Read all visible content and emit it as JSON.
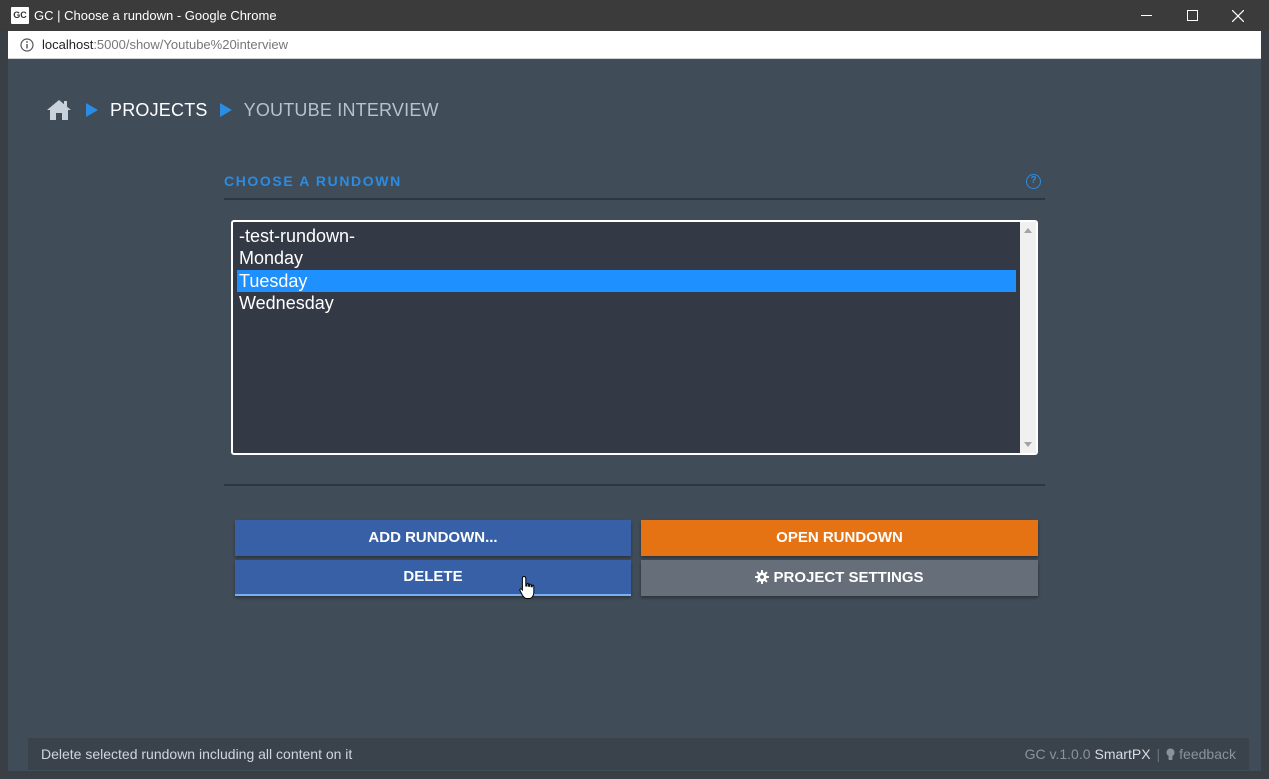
{
  "window": {
    "icon_text": "GC",
    "title": "GC | Choose a rundown - Google Chrome"
  },
  "address": {
    "host": "localhost",
    "path": ":5000/show/Youtube%20interview"
  },
  "breadcrumb": {
    "items": [
      {
        "label": "PROJECTS"
      },
      {
        "label": "YOUTUBE INTERVIEW"
      }
    ]
  },
  "section": {
    "title": "CHOOSE A RUNDOWN",
    "help_text": "?"
  },
  "rundowns": {
    "items": [
      {
        "label": "-test-rundown-",
        "selected": false
      },
      {
        "label": "Monday",
        "selected": false
      },
      {
        "label": "Tuesday",
        "selected": true
      },
      {
        "label": "Wednesday",
        "selected": false
      }
    ]
  },
  "buttons": {
    "add_label": "ADD RUNDOWN...",
    "open_label": "OPEN RUNDOWN",
    "delete_label": "DELETE",
    "settings_label": "PROJECT SETTINGS"
  },
  "status": {
    "hint": "Delete selected rundown including all content on it",
    "version": "GC v.1.0.0",
    "brand": "SmartPX",
    "separator": "|",
    "feedback": "feedback"
  },
  "icons": {
    "home": "home-icon",
    "help": "help-icon",
    "gear": "gear-icon",
    "bulb": "bulb-icon",
    "cursor": "hand-cursor-icon"
  },
  "colors": {
    "accent": "#2a8ce2",
    "primary_button": "#3760a6",
    "open_button": "#e57314",
    "settings_button": "#666e7a",
    "selection": "#1e90ff"
  }
}
